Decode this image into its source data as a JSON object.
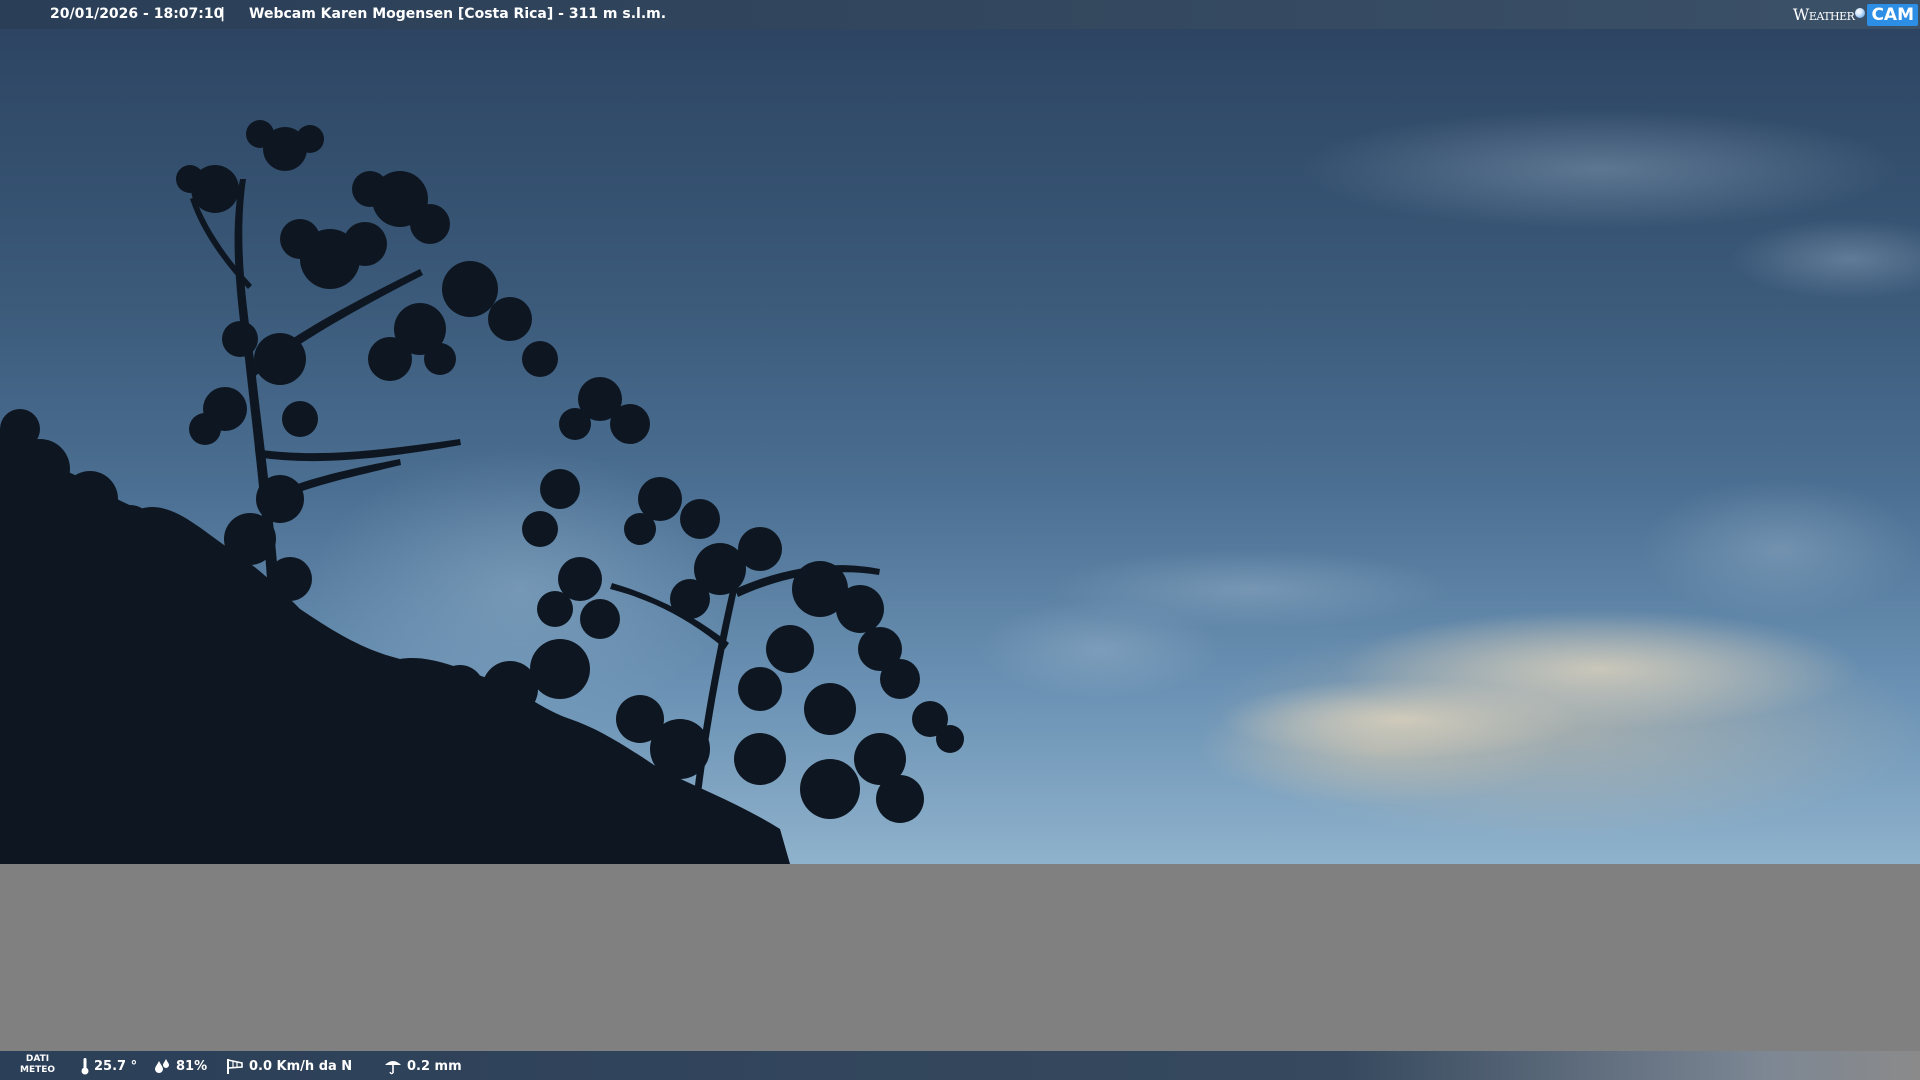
{
  "header": {
    "timestamp": "20/01/2026 - 18:07:10",
    "separator": "|",
    "title": "Webcam Karen Mogensen [Costa Rica] - 311 m s.l.m.",
    "brand_word": "Weather",
    "brand_badge": "CAM"
  },
  "footer": {
    "dati_line1": "DATI",
    "dati_line2": "METEO",
    "temperature": "25.7 °",
    "humidity": "81%",
    "wind": "0.0 Km/h da N",
    "rain": "0.2 mm"
  },
  "icons": {
    "temperature": "thermometer-icon",
    "humidity": "humidity-drops-icon",
    "wind": "wind-sock-icon",
    "rain": "rain-gauge-icon"
  },
  "colors": {
    "bar_bg": "#2f4560",
    "brand_accent": "#2d8ee6",
    "gray_block": "#808080"
  }
}
